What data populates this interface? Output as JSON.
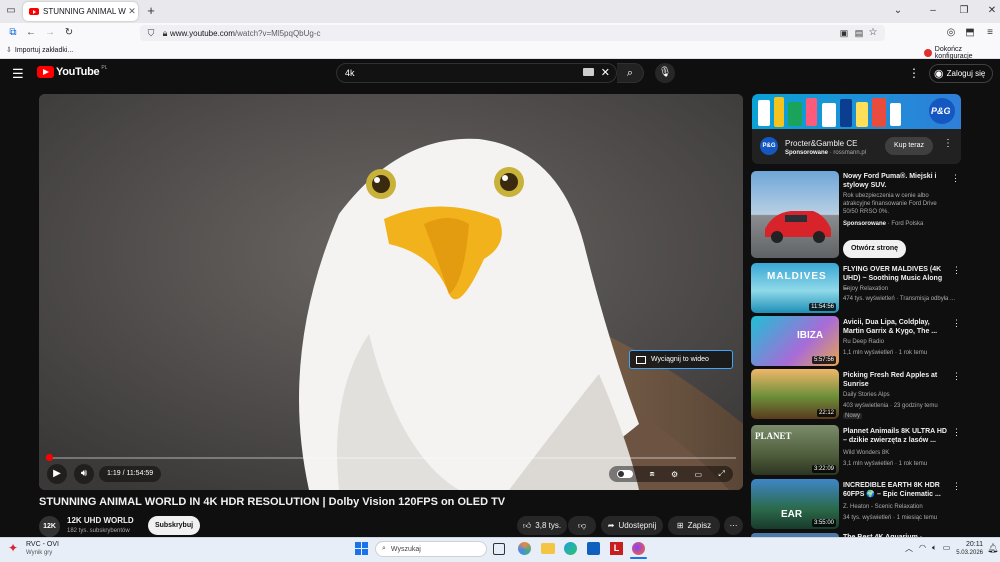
{
  "browser": {
    "tab_title": "STUNNING ANIMAL WORLD IN",
    "url_domain": "www.youtube.com",
    "url_path": "/watch?v=Ml5pqQbUg-c",
    "bookmark_import": "Importuj zakładki...",
    "finish_config": "Dokończ konfiguracje"
  },
  "header": {
    "logo": "YouTube",
    "logo_region": "PL",
    "search_value": "4k",
    "signin": "Zaloguj się"
  },
  "player": {
    "time": "1:19 / 11:54:59",
    "progress_fraction": 0.0018,
    "pip_label": "Wyciągnij to wideo"
  },
  "video": {
    "title": "STUNNING ANIMAL WORLD IN 4K HDR RESOLUTION | Dolby Vision 120FPS on OLED TV",
    "channel": "12K UHD WORLD",
    "channel_avatar": "12K",
    "subscribers": "182 tys. subskrybentów",
    "subscribe": "Subskrybuj",
    "likes": "3,8 tys.",
    "share": "Udostępnij",
    "save": "Zapisz"
  },
  "ad": {
    "advertiser": "Procter&Gamble CE",
    "sponsored": "Sponsorowane",
    "domain": "· rossmann.pl",
    "cta": "Kup teraz",
    "logo": "P&G"
  },
  "ad2": {
    "title": "Nowy Ford Puma®. Miejski i stylowy SUV.",
    "desc": "Rok ubezpieczenia w cenie albo atrakcyjne finansowanie Ford Drive 50/50 RRSO 0%.",
    "sponsored": "Sponsorowane",
    "advertiser": "· Ford Polska",
    "cta": "Otwórz stronę"
  },
  "sidebar": [
    {
      "title": "FLYING OVER MALDIVES (4K UHD) ~ Soothing Music Along ...",
      "channel": "Enjoy Relaxation",
      "meta": "474 tys. wyświetleń · Transmisja odbyła ...",
      "duration": "11:54:56",
      "thumb_text": "MALDIVES"
    },
    {
      "title": "Avicii, Dua Lipa, Coldplay, Martin Garrix & Kygo, The ...",
      "channel": "Ru Deep Radio",
      "meta": "1,1 mln wyświetleń · 1 rok temu",
      "duration": "5:57:56",
      "thumb_text": "IBIZA"
    },
    {
      "title": "Picking Fresh Red Apples at Sunrise",
      "channel": "Daily Stories Alps",
      "meta": "403 wyświetlenia · 23 godziny temu",
      "duration": "22:12",
      "badge": "Nowy"
    },
    {
      "title": "Plannet Animails 8K ULTRA HD – dzikie zwierzęta z lasów ...",
      "channel": "Wild Wonders 8K",
      "meta": "3,1 mln wyświetleń · 1 rok temu",
      "duration": "3:22:09",
      "thumb_text": "PLANET"
    },
    {
      "title": "INCREDIBLE EARTH 8K HDR 60FPS 🌍 – Epic Cinematic ...",
      "channel": "Z. Heaton - Scenic Relaxation",
      "meta": "34 tys. wyświetleń · 1 miesiąc temu",
      "duration": "3:55:00",
      "thumb_text": "EAR"
    },
    {
      "title": "The Best 4K Aquarium - Explore ..."
    }
  ],
  "taskbar": {
    "weather_title": "RVC - OVI",
    "weather_sub": "Wynik gry",
    "search": "Wyszukaj",
    "time": "20:11",
    "date": "5.03.2026"
  }
}
